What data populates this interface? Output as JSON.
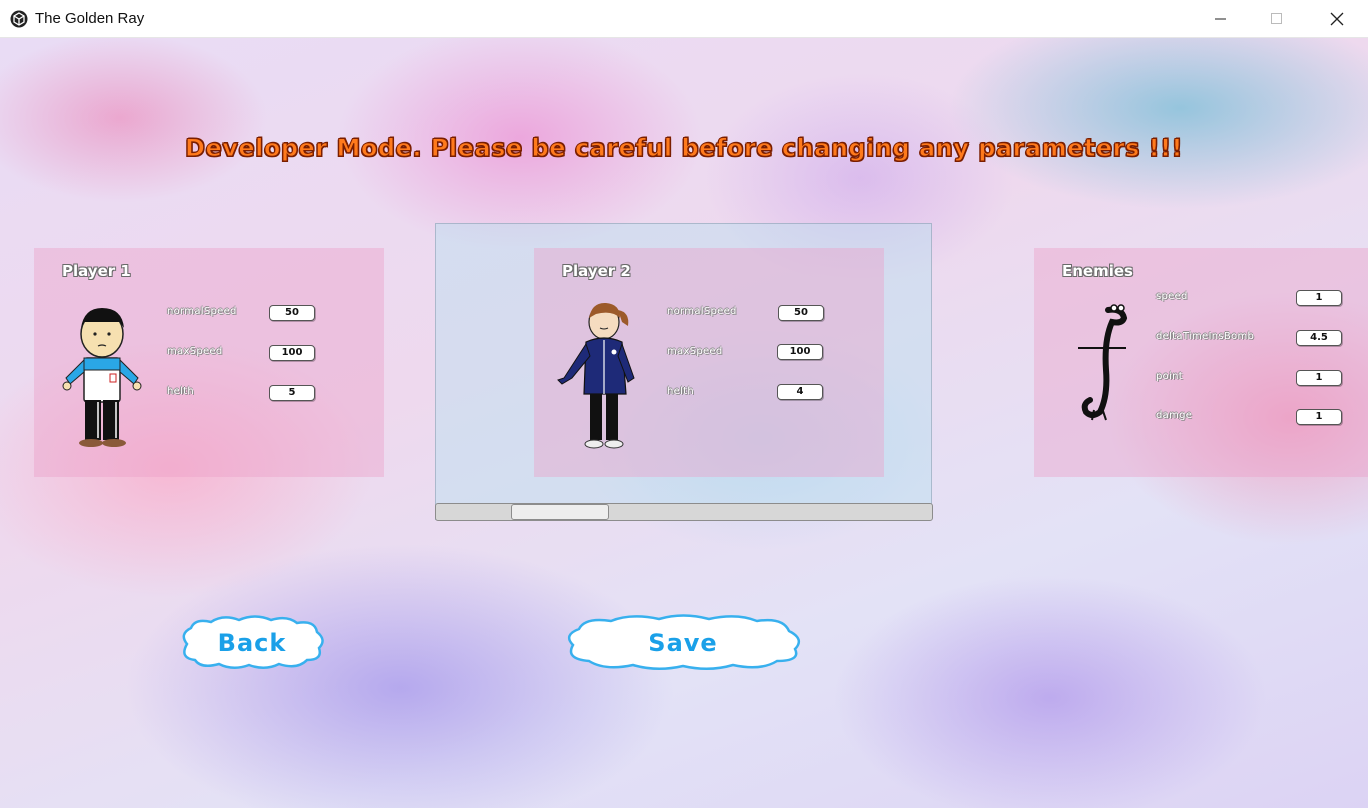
{
  "window": {
    "title": "The Golden Ray",
    "icon": "unity-cube-icon"
  },
  "warning": "Developer Mode. Please be careful before changing any parameters !!!",
  "players": [
    {
      "title": "Player 1",
      "params": [
        {
          "label": "normalSpeed",
          "value": "50"
        },
        {
          "label": "maxSpeed",
          "value": "100"
        },
        {
          "label": "helth",
          "value": "5"
        }
      ]
    },
    {
      "title": "Player 2",
      "params": [
        {
          "label": "normalSpeed",
          "value": "50"
        },
        {
          "label": "maxSpeed",
          "value": "100"
        },
        {
          "label": "helth",
          "value": "4"
        }
      ]
    }
  ],
  "enemies": {
    "title": "Enemies",
    "params": [
      {
        "label": "speed",
        "value": "1"
      },
      {
        "label": "deltaTimeInsBomb",
        "value": "4.5"
      },
      {
        "label": "point",
        "value": "1"
      },
      {
        "label": "damge",
        "value": "1"
      }
    ]
  },
  "buttons": {
    "back": "Back",
    "save": "Save"
  },
  "colors": {
    "warning_text": "#ff7a1c",
    "button_text": "#1aa0e8",
    "panel": "#eca0c8"
  }
}
